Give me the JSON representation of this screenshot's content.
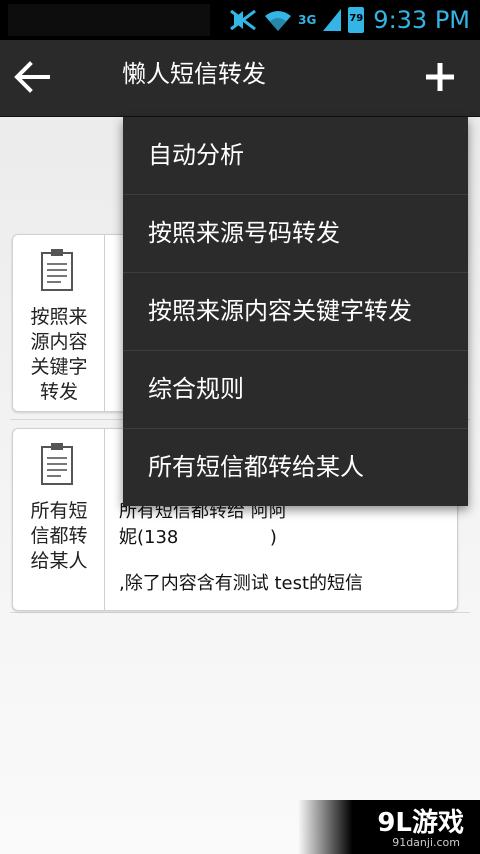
{
  "status_bar": {
    "time": "9:33 PM",
    "network_type": "3G",
    "battery_level": "79",
    "icons": [
      "mute-icon",
      "wifi-icon",
      "signal-icon",
      "battery-icon"
    ],
    "accent_color": "#33b5e5"
  },
  "action_bar": {
    "title": "懒人短信转发",
    "icons": [
      "back-arrow-icon",
      "plus-icon"
    ]
  },
  "rules": [
    {
      "label": "按照来源内容关键字转发",
      "label_lines": [
        "按照来",
        "源内容",
        "关键字",
        "转发"
      ],
      "icon": "clipboard-icon"
    },
    {
      "label": "所有短信都转给某人",
      "label_lines": [
        "所有短",
        "信都转",
        "给某人"
      ],
      "icon": "clipboard-icon",
      "text_lines": [
        "所有短信都转给 阿阿",
        "妮(138                )",
        "",
        ",除了内容含有测试 test的短信"
      ]
    }
  ],
  "menu": {
    "items": [
      "自动分析",
      "按照来源号码转发",
      "按照来源内容关键字转发",
      "综合规则",
      "所有短信都转给某人"
    ]
  },
  "watermark": {
    "text": "9L游戏",
    "subtext": "91danji.com"
  }
}
